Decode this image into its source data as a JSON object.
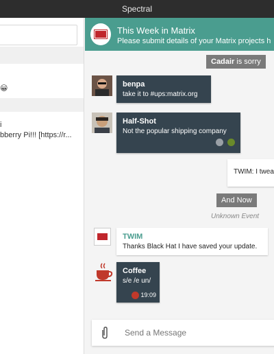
{
  "window": {
    "title": "Spectral"
  },
  "sidebar": {
    "row1_text": "😀",
    "row2_title": "i",
    "row2_preview": "bberry Pi!!! [https://r..."
  },
  "room": {
    "name": "This Week in Matrix",
    "topic": "Please submit details of your Matrix projects h"
  },
  "timeline": {
    "state1": {
      "actor": "Cadair",
      "text": " is sorry"
    },
    "msg1": {
      "sender": "benpa",
      "body": "take it to #ups:matrix.org"
    },
    "msg2": {
      "sender": "Half-Shot",
      "body": "Not the popular shipping company"
    },
    "msg3": {
      "body": "TWIM: I twea"
    },
    "state2": {
      "text": "And Now"
    },
    "unknown_event": "Unknown Event",
    "msg4": {
      "sender": "TWIM",
      "body": "Thanks Black Hat I have saved your update."
    },
    "msg5": {
      "sender": "Coffee",
      "body": "s/e /e un/",
      "time": "19:09"
    }
  },
  "composer": {
    "placeholder": "Send a Message"
  },
  "colors": {
    "accent": "#4a9d8f",
    "bubble": "#35444f",
    "titlebar": "#2d2d2d"
  }
}
